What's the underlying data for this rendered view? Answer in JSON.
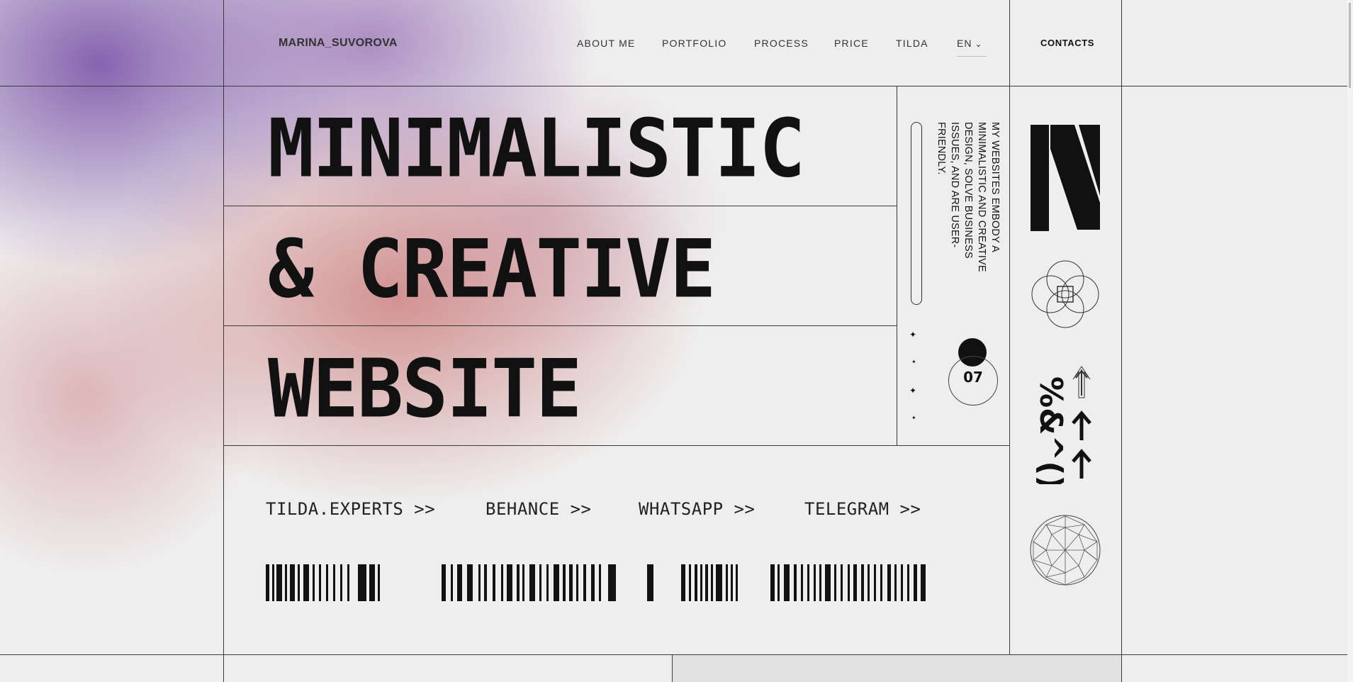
{
  "header": {
    "brand": "MARINA_SUVOROVA",
    "nav": [
      "ABOUT ME",
      "PORTFOLIO",
      "PROCESS",
      "PRICE",
      "TILDA"
    ],
    "lang": "EN",
    "contacts": "CONTACTS"
  },
  "hero": {
    "line1": "MINIMALISTIC",
    "line2": "& CREATIVE",
    "line3": "WEBSITE"
  },
  "aside": {
    "description": "MY WEBSITES EMBODY A MINIMALISTIC AND CREATIVE DESIGN, SOLVE BUSINESS ISSUES, AND ARE USER-FRIENDLY.",
    "counter": "07"
  },
  "links": [
    "TILDA.EXPERTS >>",
    "BEHANCE >>",
    "WHATSAPP >>",
    "TELEGRAM >>"
  ],
  "icons": {
    "monogram": "m-monogram-icon",
    "knot": "interlocking-circles-icon",
    "symbols": "symbols-arrows-icon",
    "geodesic": "geodesic-sphere-icon"
  },
  "colors": {
    "purple": "#805cac",
    "pink": "#cd8282",
    "background": "#efeeee",
    "ink": "#111111"
  }
}
